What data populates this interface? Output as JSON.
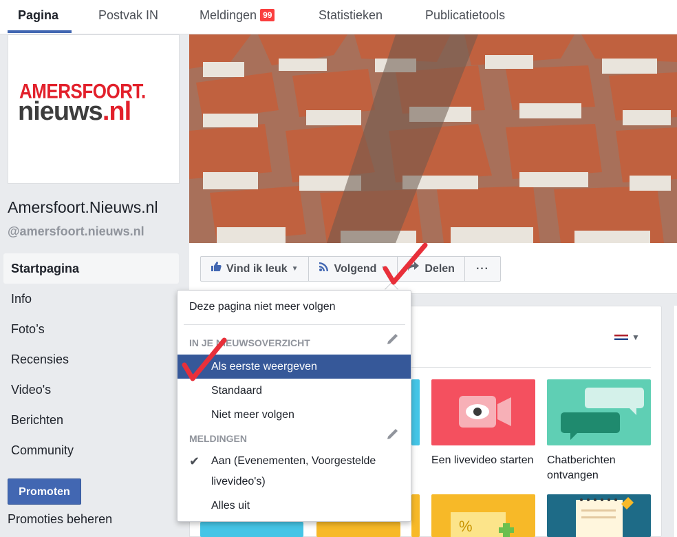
{
  "topnav": {
    "tabs": [
      {
        "label": "Pagina"
      },
      {
        "label": "Postvak IN"
      },
      {
        "label": "Meldingen",
        "badge": "99"
      },
      {
        "label": "Statistieken"
      },
      {
        "label": "Publicatietools"
      }
    ]
  },
  "profile": {
    "logo_top": "AMERSFOORT.",
    "logo_bottom_main": "nieuws",
    "logo_bottom_accent": ".nl",
    "name": "Amersfoort.Nieuws.nl",
    "handle": "@amersfoort.nieuws.nl"
  },
  "sidebar": {
    "items": [
      {
        "label": "Startpagina"
      },
      {
        "label": "Info"
      },
      {
        "label": "Foto’s"
      },
      {
        "label": "Recensies"
      },
      {
        "label": "Video's"
      },
      {
        "label": "Berichten"
      },
      {
        "label": "Community"
      }
    ],
    "promote_label": "Promoten",
    "manage_label": "Promoties beheren"
  },
  "actions": {
    "like_label": "Vind ik leuk",
    "follow_label": "Volgend",
    "share_label": "Delen",
    "more_label": "···"
  },
  "dropdown": {
    "unfollow_page": "Deze pagina niet meer volgen",
    "section_feed": "IN JE NIEUWSOVERZICHT",
    "feed_options": [
      {
        "label": "Als eerste weergeven"
      },
      {
        "label": "Standaard"
      },
      {
        "label": "Niet meer volgen"
      }
    ],
    "section_notifications": "MELDINGEN",
    "notif_on": "Aan (Evenementen, Voorgestelde livevideo's)",
    "notif_off": "Alles uit"
  },
  "tiles": [
    {
      "label": "Een livevideo starten",
      "color": "#f4505f"
    },
    {
      "label": "Chatberichten ontvangen",
      "color": "#5fcfb4"
    }
  ],
  "colors": {
    "accent": "#4267b2",
    "selected": "#365899",
    "badge": "#fa3e3e",
    "annotation": "#e8303a"
  }
}
